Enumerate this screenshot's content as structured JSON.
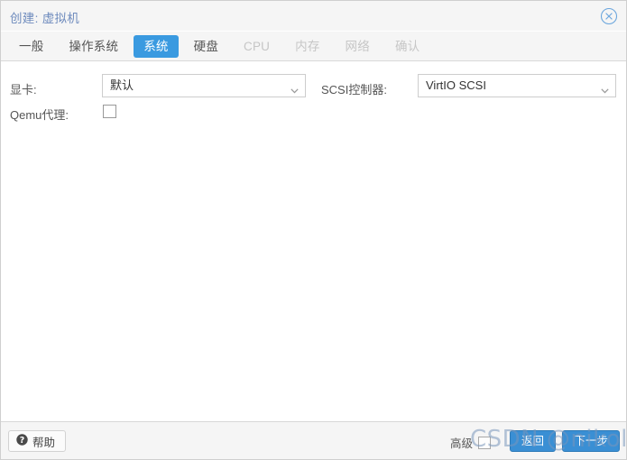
{
  "window": {
    "title": "创建: 虚拟机",
    "close_icon": "close-circle-icon"
  },
  "tabs": [
    {
      "label": "一般",
      "state": "normal"
    },
    {
      "label": "操作系统",
      "state": "normal"
    },
    {
      "label": "系统",
      "state": "active"
    },
    {
      "label": "硬盘",
      "state": "normal"
    },
    {
      "label": "CPU",
      "state": "disabled"
    },
    {
      "label": "内存",
      "state": "disabled"
    },
    {
      "label": "网络",
      "state": "disabled"
    },
    {
      "label": "确认",
      "state": "disabled"
    }
  ],
  "form": {
    "graphic_card": {
      "label": "显卡:",
      "value": "默认",
      "arrow_icon": "chevron-down-icon"
    },
    "scsi_controller": {
      "label": "SCSI控制器:",
      "value": "VirtIO SCSI",
      "arrow_icon": "chevron-down-icon"
    },
    "qemu_agent": {
      "label": "Qemu代理:",
      "checked": false
    }
  },
  "footer": {
    "help_label": "帮助",
    "help_icon": "question-mark-icon",
    "advanced_label": "高级",
    "advanced_checked": false,
    "back_label": "返回",
    "next_label": "下一步"
  },
  "watermark": {
    "text": "CSDN @nikolay"
  },
  "colors": {
    "accent": "#3a9ae0",
    "button": "#3a8fd4",
    "title_text": "#6e8bbd",
    "chrome": "#f5f5f5"
  }
}
